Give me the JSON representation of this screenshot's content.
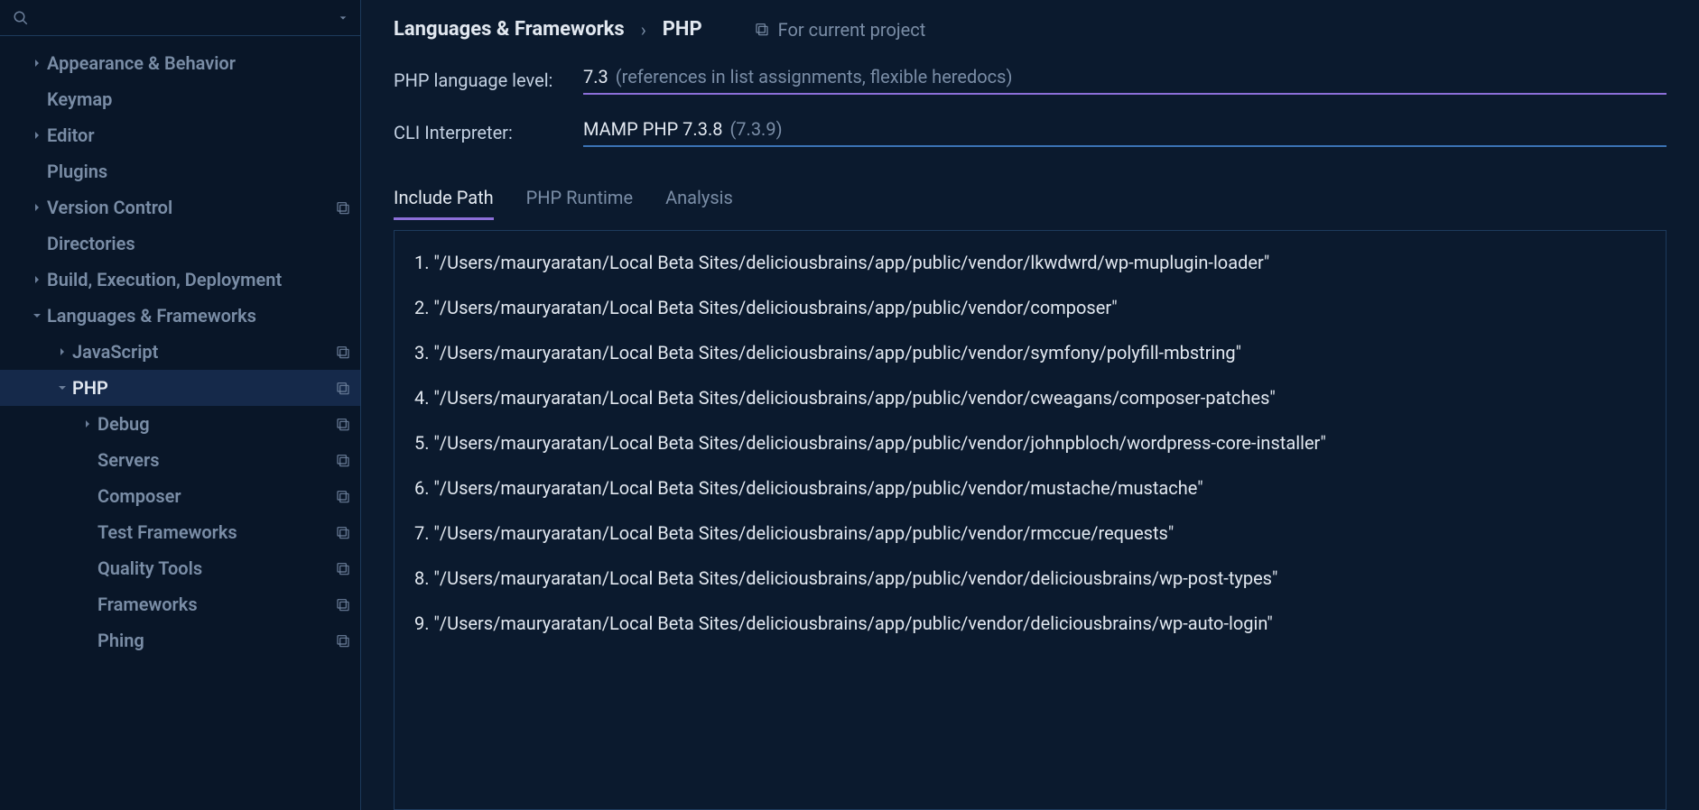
{
  "sidebar": {
    "search_placeholder": "",
    "items": [
      {
        "label": "Appearance & Behavior",
        "depth": 0,
        "expandable": true,
        "expanded": false,
        "project_scope": false
      },
      {
        "label": "Keymap",
        "depth": 0,
        "expandable": false,
        "expanded": false,
        "project_scope": false
      },
      {
        "label": "Editor",
        "depth": 0,
        "expandable": true,
        "expanded": false,
        "project_scope": false
      },
      {
        "label": "Plugins",
        "depth": 0,
        "expandable": false,
        "expanded": false,
        "project_scope": false
      },
      {
        "label": "Version Control",
        "depth": 0,
        "expandable": true,
        "expanded": false,
        "project_scope": true
      },
      {
        "label": "Directories",
        "depth": 0,
        "expandable": false,
        "expanded": false,
        "project_scope": false
      },
      {
        "label": "Build, Execution, Deployment",
        "depth": 0,
        "expandable": true,
        "expanded": false,
        "project_scope": false
      },
      {
        "label": "Languages & Frameworks",
        "depth": 0,
        "expandable": true,
        "expanded": true,
        "project_scope": false
      },
      {
        "label": "JavaScript",
        "depth": 1,
        "expandable": true,
        "expanded": false,
        "project_scope": true
      },
      {
        "label": "PHP",
        "depth": 1,
        "expandable": true,
        "expanded": true,
        "project_scope": true,
        "selected": true
      },
      {
        "label": "Debug",
        "depth": 2,
        "expandable": true,
        "expanded": false,
        "project_scope": true
      },
      {
        "label": "Servers",
        "depth": 2,
        "expandable": false,
        "expanded": false,
        "project_scope": true
      },
      {
        "label": "Composer",
        "depth": 2,
        "expandable": false,
        "expanded": false,
        "project_scope": true
      },
      {
        "label": "Test Frameworks",
        "depth": 2,
        "expandable": false,
        "expanded": false,
        "project_scope": true
      },
      {
        "label": "Quality Tools",
        "depth": 2,
        "expandable": false,
        "expanded": false,
        "project_scope": true
      },
      {
        "label": "Frameworks",
        "depth": 2,
        "expandable": false,
        "expanded": false,
        "project_scope": true
      },
      {
        "label": "Phing",
        "depth": 2,
        "expandable": false,
        "expanded": false,
        "project_scope": true
      }
    ]
  },
  "breadcrumb": {
    "parent": "Languages & Frameworks",
    "sep": "›",
    "child": "PHP",
    "scope_label": "For current project"
  },
  "fields": {
    "lang_level_label": "PHP language level:",
    "lang_level_value": "7.3",
    "lang_level_hint": "(references in list assignments, flexible heredocs)",
    "cli_label": "CLI Interpreter:",
    "cli_value": "MAMP PHP 7.3.8",
    "cli_hint": "(7.3.9)"
  },
  "tabs": {
    "items": [
      "Include Path",
      "PHP Runtime",
      "Analysis"
    ],
    "active_index": 0
  },
  "include_paths": [
    "\"/Users/mauryaratan/Local Beta Sites/deliciousbrains/app/public/vendor/lkwdwrd/wp-muplugin-loader\"",
    "\"/Users/mauryaratan/Local Beta Sites/deliciousbrains/app/public/vendor/composer\"",
    "\"/Users/mauryaratan/Local Beta Sites/deliciousbrains/app/public/vendor/symfony/polyfill-mbstring\"",
    "\"/Users/mauryaratan/Local Beta Sites/deliciousbrains/app/public/vendor/cweagans/composer-patches\"",
    "\"/Users/mauryaratan/Local Beta Sites/deliciousbrains/app/public/vendor/johnpbloch/wordpress-core-installer\"",
    "\"/Users/mauryaratan/Local Beta Sites/deliciousbrains/app/public/vendor/mustache/mustache\"",
    "\"/Users/mauryaratan/Local Beta Sites/deliciousbrains/app/public/vendor/rmccue/requests\"",
    "\"/Users/mauryaratan/Local Beta Sites/deliciousbrains/app/public/vendor/deliciousbrains/wp-post-types\"",
    "\"/Users/mauryaratan/Local Beta Sites/deliciousbrains/app/public/vendor/deliciousbrains/wp-auto-login\""
  ]
}
